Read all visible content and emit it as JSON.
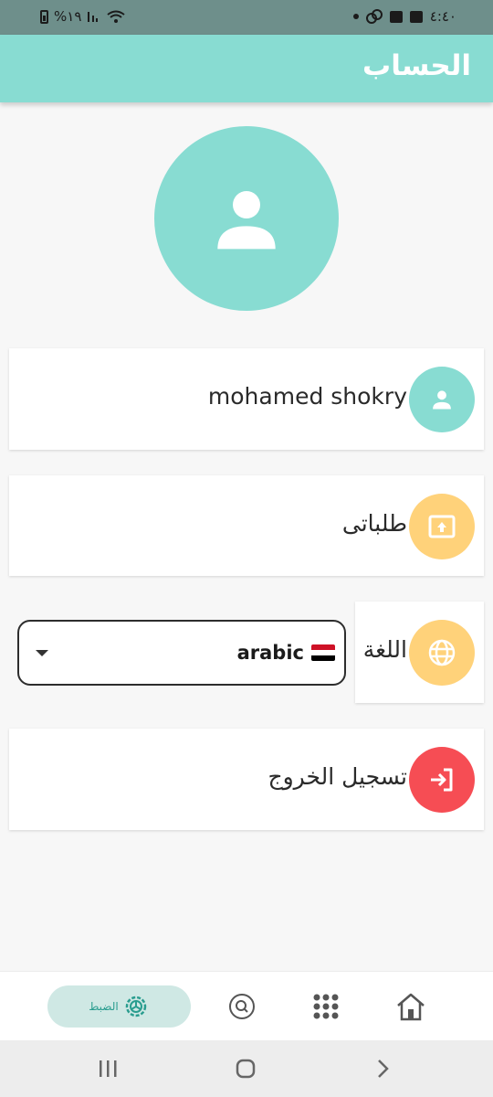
{
  "status_bar": {
    "battery_text": "%١٩",
    "time": "٤:٤٠"
  },
  "app_bar": {
    "title": "الحساب"
  },
  "profile": {
    "name": "mohamed shokry"
  },
  "menu": {
    "orders_label": "طلباتى",
    "language_label": "اللغة",
    "language_value": "arabic",
    "logout_label": "تسجيل الخروج"
  },
  "bottom_nav": {
    "settings_label": "الضبط",
    "active_tab": "settings"
  },
  "colors": {
    "accent": "#88dcd2",
    "orders_icon_bg": "#ffd27a",
    "language_icon_bg": "#ffd27a",
    "logout_icon_bg": "#f64d54",
    "active_tab_bg": "#cfe8e4"
  },
  "icons": [
    "person-icon",
    "upload-icon",
    "globe-icon",
    "logout-icon",
    "settings-icon",
    "search-icon",
    "grid-icon",
    "home-icon"
  ]
}
